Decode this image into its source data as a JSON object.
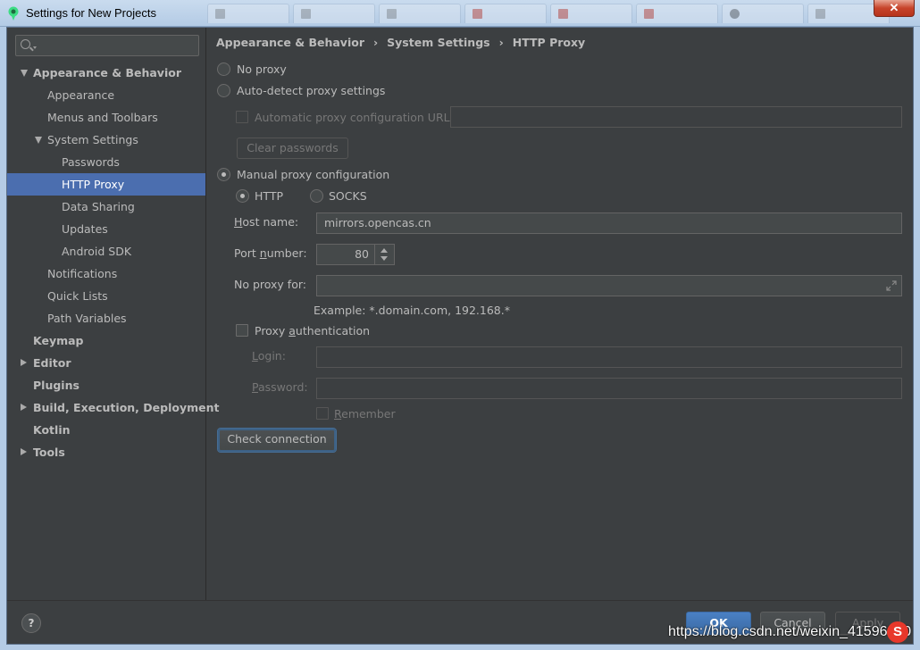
{
  "window": {
    "title": "Settings for New Projects",
    "close_glyph": "✕"
  },
  "search": {
    "value": ""
  },
  "breadcrumb": [
    "Appearance & Behavior",
    "System Settings",
    "HTTP Proxy"
  ],
  "breadcrumb_sep": "›",
  "tree": [
    {
      "label": "Appearance & Behavior",
      "level": 0,
      "bold": true,
      "arrow": "down"
    },
    {
      "label": "Appearance",
      "level": 1
    },
    {
      "label": "Menus and Toolbars",
      "level": 1
    },
    {
      "label": "System Settings",
      "level": 1,
      "arrow": "down"
    },
    {
      "label": "Passwords",
      "level": 2
    },
    {
      "label": "HTTP Proxy",
      "level": 2,
      "selected": true
    },
    {
      "label": "Data Sharing",
      "level": 2
    },
    {
      "label": "Updates",
      "level": 2
    },
    {
      "label": "Android SDK",
      "level": 2
    },
    {
      "label": "Notifications",
      "level": 1
    },
    {
      "label": "Quick Lists",
      "level": 1
    },
    {
      "label": "Path Variables",
      "level": 1
    },
    {
      "label": "Keymap",
      "level": 0,
      "bold": true
    },
    {
      "label": "Editor",
      "level": 0,
      "bold": true,
      "arrow": "right"
    },
    {
      "label": "Plugins",
      "level": 0,
      "bold": true
    },
    {
      "label": "Build, Execution, Deployment",
      "level": 0,
      "bold": true,
      "arrow": "right"
    },
    {
      "label": "Kotlin",
      "level": 0,
      "bold": true
    },
    {
      "label": "Tools",
      "level": 0,
      "bold": true,
      "arrow": "right"
    }
  ],
  "proxy": {
    "no_proxy": "No proxy",
    "auto_detect": "Auto-detect proxy settings",
    "auto_config_url_label": "Automatic proxy configuration URL:",
    "auto_config_url_value": "",
    "clear_passwords": "Clear passwords",
    "manual": "Manual proxy configuration",
    "selected_mode": "manual",
    "http": "HTTP",
    "socks": "SOCKS",
    "selected_protocol": "HTTP",
    "host_label_mnemonic": "H",
    "host_label_rest": "ost name:",
    "host_value": "mirrors.opencas.cn",
    "port_label_pre": "Port ",
    "port_label_mnemonic": "n",
    "port_label_post": "umber:",
    "port_value": "80",
    "no_proxy_for_label": "No proxy for:",
    "no_proxy_for_value": "",
    "example": "Example: *.domain.com, 192.168.*",
    "auth_pre": "Proxy ",
    "auth_mnemonic": "a",
    "auth_post": "uthentication",
    "login_mnemonic": "L",
    "login_rest": "ogin:",
    "password_mnemonic": "P",
    "password_rest": "assword:",
    "remember_mnemonic": "R",
    "remember_rest": "emember",
    "check_connection": "Check connection"
  },
  "buttons": {
    "help": "?",
    "ok": "OK",
    "cancel": "Cancel",
    "apply": "Apply"
  },
  "watermark": "https://blog.csdn.net/weixin_41596250",
  "watermark_logo": "S",
  "colors": {
    "selection": "#4b6eaf",
    "background": "#3c3f41",
    "ok_button": "#3b6aa3"
  }
}
